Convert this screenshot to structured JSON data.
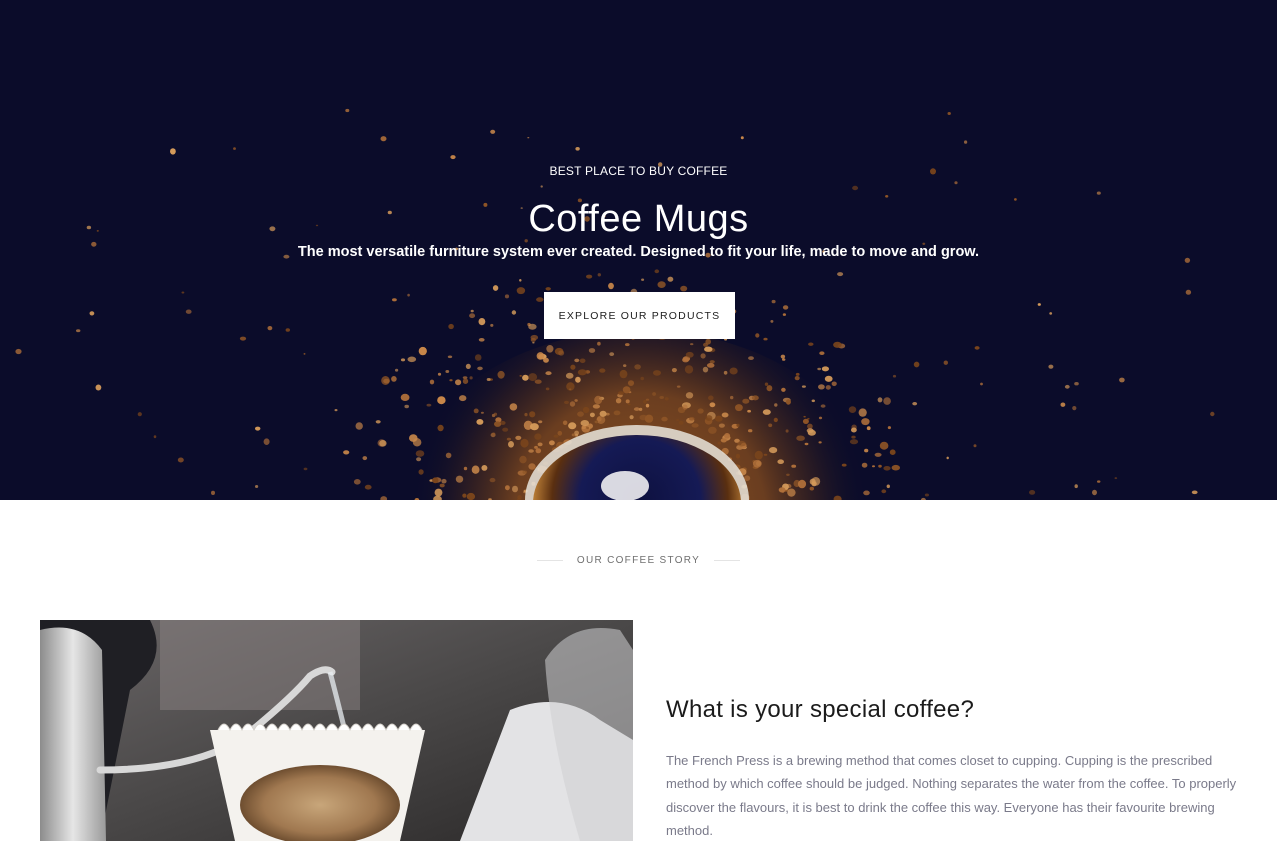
{
  "hero": {
    "eyebrow": "BEST PLACE TO BUY COFFEE",
    "title": "Coffee Mugs",
    "subtitle": "The most versatile furniture system ever created. Designed to fit your life, made to move and grow.",
    "cta_label": "EXPLORE OUR PRODUCTS",
    "background_color": "#0b0c2a",
    "accent_color": "#b0703a"
  },
  "story": {
    "section_label": "OUR COFFEE STORY",
    "heading": "What is your special coffee?",
    "body": "The French Press is a brewing method that comes closet to cupping. Cupping is the prescribed method by which coffee should be judged. Nothing separates the water from the coffee. To properly discover the flavours, it is best to drink the coffee this way. Everyone has their favourite brewing method."
  }
}
